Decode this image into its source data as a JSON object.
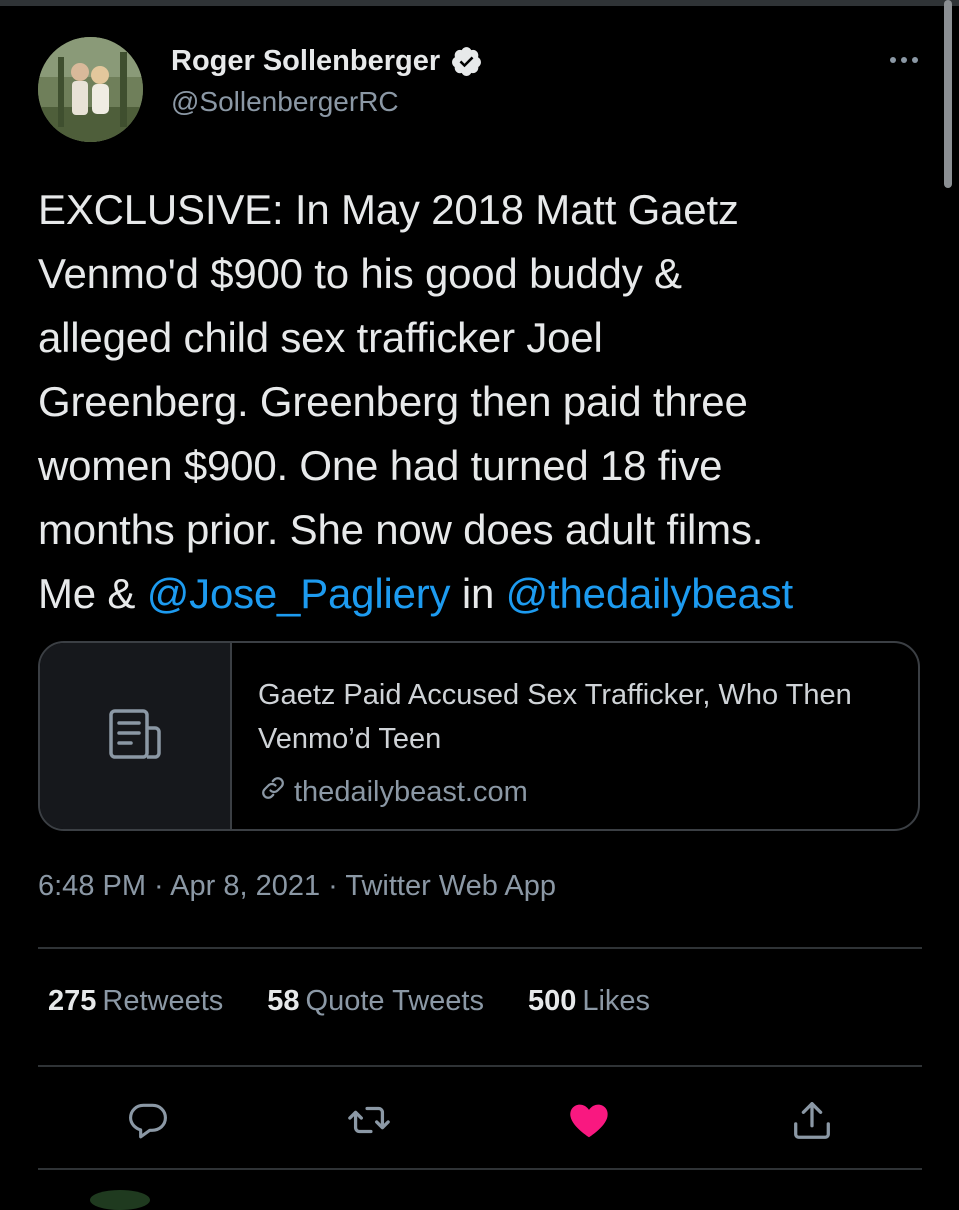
{
  "tweet": {
    "author_name": "Roger Sollenberger",
    "author_handle": "@SollenbergerRC",
    "text_plain": "EXCLUSIVE: In May 2018 Matt Gaetz\nVenmo'd $900 to his good buddy &\nalleged child sex trafficker Joel\nGreenberg. Greenberg then paid three\nwomen $900. One had turned 18 five\nmonths prior. She now does adult films.\nMe & ",
    "mention_1": "@Jose_Pagliery",
    "text_between": " in ",
    "mention_2": "@thedailybeast",
    "meta": "6:48 PM · Apr 8, 2021 · Twitter Web App"
  },
  "card": {
    "title": "Gaetz Paid Accused Sex Trafficker, Who Then Venmo’d Teen",
    "domain": "thedailybeast.com"
  },
  "stats": {
    "retweets_count": "275",
    "retweets_label": "Retweets",
    "quotes_count": "58",
    "quotes_label": "Quote Tweets",
    "likes_count": "500",
    "likes_label": "Likes"
  },
  "icons": {
    "verified": "verified-badge-icon",
    "more": "more-icon",
    "article": "article-icon",
    "link": "link-icon",
    "reply": "reply-icon",
    "retweet": "retweet-icon",
    "like": "heart-icon",
    "share": "share-icon"
  },
  "colors": {
    "background": "#000000",
    "mention": "#1d9bf0",
    "like_active": "#f91880",
    "secondary_text": "#8b98a5"
  }
}
